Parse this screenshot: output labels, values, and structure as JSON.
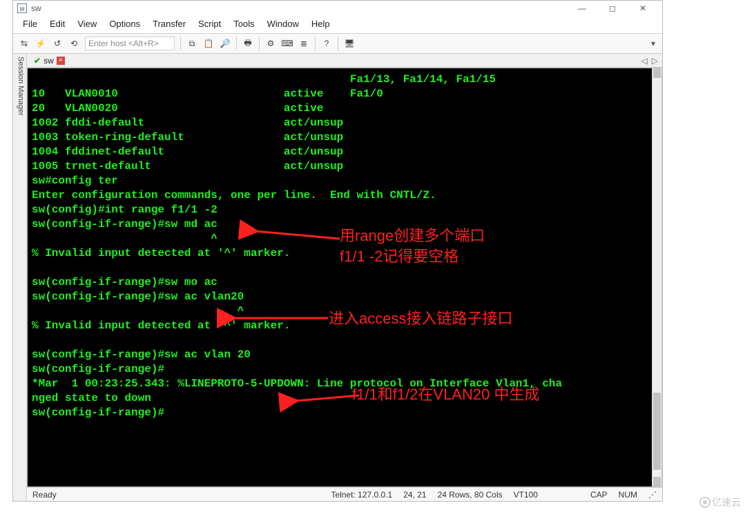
{
  "title": "sw",
  "menu": [
    "File",
    "Edit",
    "View",
    "Options",
    "Transfer",
    "Script",
    "Tools",
    "Window",
    "Help"
  ],
  "host_placeholder": "Enter host <Alt+R>",
  "sidebar_label": "Session Manager",
  "tab": {
    "name": "sw"
  },
  "toolbar_icons": {
    "g1": [
      "connect",
      "quick",
      "reconnect",
      "disconnect"
    ],
    "g2": [
      "copy",
      "paste",
      "find"
    ],
    "g3": [
      "print"
    ],
    "g4": [
      "options",
      "keyboard",
      "run-script"
    ],
    "g5": [
      "help"
    ],
    "g6": [
      "sftp"
    ]
  },
  "terminal_lines": [
    "                                                Fa1/13, Fa1/14, Fa1/15",
    "10   VLAN0010                         active    Fa1/0",
    "20   VLAN0020                         active",
    "1002 fddi-default                     act/unsup",
    "1003 token-ring-default               act/unsup",
    "1004 fddinet-default                  act/unsup",
    "1005 trnet-default                    act/unsup",
    "sw#config ter",
    "Enter configuration commands, one per line.  End with CNTL/Z.",
    "sw(config)#int range f1/1 -2",
    "sw(config-if-range)#sw md ac",
    "                           ^",
    "% Invalid input detected at '^' marker.",
    "",
    "sw(config-if-range)#sw mo ac",
    "sw(config-if-range)#sw ac vlan20",
    "                               ^",
    "% Invalid input detected at '^' marker.",
    "",
    "sw(config-if-range)#sw ac vlan 20",
    "sw(config-if-range)#",
    "*Mar  1 00:23:25.343: %LINEPROTO-5-UPDOWN: Line protocol on Interface Vlan1, cha",
    "nged state to down",
    "sw(config-if-range)#"
  ],
  "annotations": {
    "a1_line1": "用range创建多个端口",
    "a1_line2": "f1/1 -2记得要空格",
    "a2": "进入access接入链路子接口",
    "a3": "f1/1和f1/2在VLAN20 中生成"
  },
  "status": {
    "ready": "Ready",
    "conn": "Telnet: 127.0.0.1",
    "pos": "24,  21",
    "size": "24 Rows, 80 Cols",
    "emul": "VT100",
    "cap": "CAP",
    "num": "NUM"
  },
  "watermark": "亿速云"
}
